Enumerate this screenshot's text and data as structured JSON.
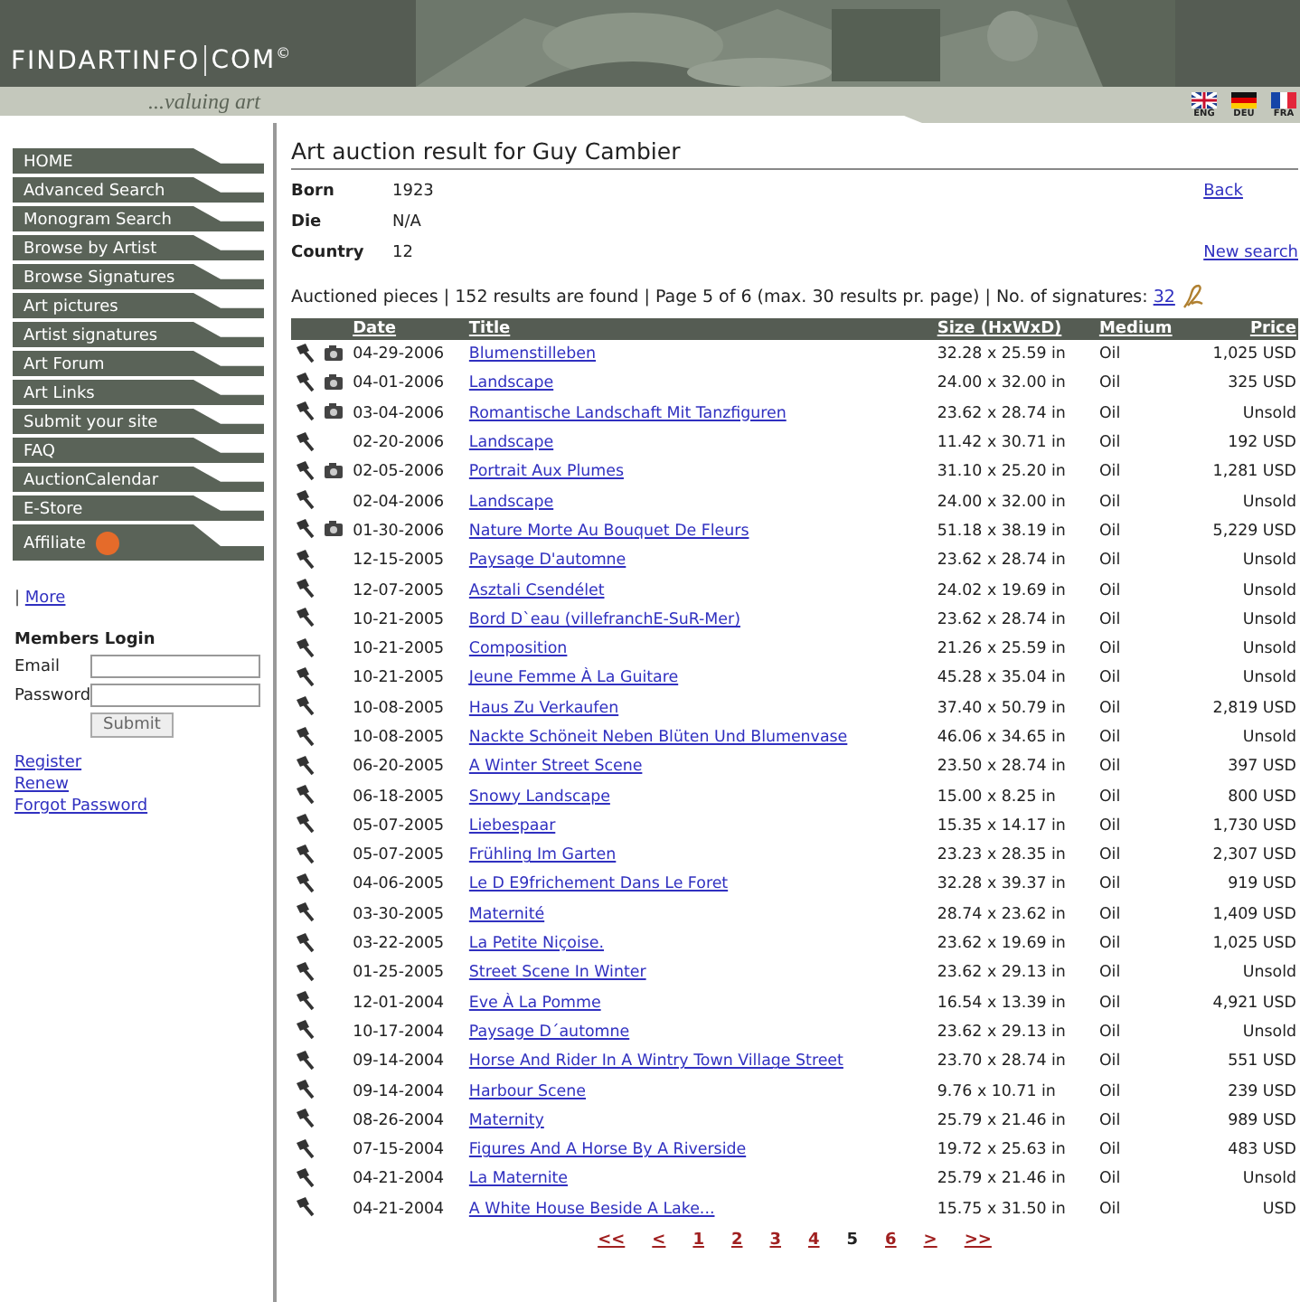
{
  "header": {
    "logo": "FINDARTINFO",
    "logo_suffix": "COM",
    "logo_mark": "©",
    "tagline": "...valuing art",
    "languages": [
      {
        "code": "ENG",
        "kind": "uk"
      },
      {
        "code": "DEU",
        "kind": "de"
      },
      {
        "code": "FRA",
        "kind": "fr"
      }
    ]
  },
  "sidebar": {
    "menu": [
      {
        "label": "HOME",
        "badge": false
      },
      {
        "label": "Advanced Search",
        "badge": false
      },
      {
        "label": "Monogram Search",
        "badge": false
      },
      {
        "label": "Browse by Artist",
        "badge": false
      },
      {
        "label": "Browse Signatures",
        "badge": false
      },
      {
        "label": "Art pictures",
        "badge": false
      },
      {
        "label": "Artist signatures",
        "badge": false
      },
      {
        "label": "Art Forum",
        "badge": false
      },
      {
        "label": "Art Links",
        "badge": false
      },
      {
        "label": "Submit your site",
        "badge": false
      },
      {
        "label": "FAQ",
        "badge": false
      },
      {
        "label": "AuctionCalendar",
        "badge": false
      },
      {
        "label": "E-Store",
        "badge": false
      },
      {
        "label": "Affiliate",
        "badge": true
      }
    ],
    "more_separator": "|",
    "more": "More",
    "login": {
      "title": "Members Login",
      "email_label": "Email",
      "password_label": "Password",
      "submit": "Submit",
      "links": [
        "Register",
        "Renew",
        "Forgot Password"
      ]
    }
  },
  "main": {
    "title": "Art auction result for Guy Cambier",
    "info": [
      {
        "label": "Born",
        "value": "1923",
        "link": "Back"
      },
      {
        "label": "Die",
        "value": "N/A"
      },
      {
        "label": "Country",
        "value": "12",
        "link": "New search"
      }
    ],
    "summary": "Auctioned pieces | 152 results are found | Page 5 of 6 (max. 30 results pr. page) | No. of signatures: ",
    "signatures": "32",
    "table": {
      "columns": [
        "Date",
        "Title",
        "Size (HxWxD)",
        "Medium",
        "Price"
      ],
      "rows": [
        {
          "photo": true,
          "date": "04-29-2006",
          "title": "Blumenstilleben",
          "size": "32.28 x 25.59 in",
          "medium": "Oil",
          "price": "1,025 USD"
        },
        {
          "photo": true,
          "date": "04-01-2006",
          "title": "Landscape",
          "size": "24.00 x 32.00 in",
          "medium": "Oil",
          "price": "325 USD"
        },
        {
          "photo": true,
          "date": "03-04-2006",
          "title": "Romantische Landschaft Mit Tanzfiguren",
          "size": "23.62 x 28.74 in",
          "medium": "Oil",
          "price": "Unsold"
        },
        {
          "photo": false,
          "date": "02-20-2006",
          "title": "Landscape",
          "size": "11.42 x 30.71 in",
          "medium": "Oil",
          "price": "192 USD"
        },
        {
          "photo": true,
          "date": "02-05-2006",
          "title": "Portrait Aux Plumes",
          "size": "31.10 x 25.20 in",
          "medium": "Oil",
          "price": "1,281 USD"
        },
        {
          "photo": false,
          "date": "02-04-2006",
          "title": "Landscape",
          "size": "24.00 x 32.00 in",
          "medium": "Oil",
          "price": "Unsold"
        },
        {
          "photo": true,
          "date": "01-30-2006",
          "title": "Nature Morte Au Bouquet De Fleurs",
          "size": "51.18 x 38.19 in",
          "medium": "Oil",
          "price": "5,229 USD"
        },
        {
          "photo": false,
          "date": "12-15-2005",
          "title": "Paysage D'automne",
          "size": "23.62 x 28.74 in",
          "medium": "Oil",
          "price": "Unsold"
        },
        {
          "photo": false,
          "date": "12-07-2005",
          "title": "Asztali Csendélet",
          "size": "24.02 x 19.69 in",
          "medium": "Oil",
          "price": "Unsold"
        },
        {
          "photo": false,
          "date": "10-21-2005",
          "title": "Bord D`eau (villefranchE-SuR-Mer)",
          "size": "23.62 x 28.74 in",
          "medium": "Oil",
          "price": "Unsold"
        },
        {
          "photo": false,
          "date": "10-21-2005",
          "title": "Composition",
          "size": "21.26 x 25.59 in",
          "medium": "Oil",
          "price": "Unsold"
        },
        {
          "photo": false,
          "date": "10-21-2005",
          "title": "Jeune Femme À La Guitare",
          "size": "45.28 x 35.04 in",
          "medium": "Oil",
          "price": "Unsold"
        },
        {
          "photo": false,
          "date": "10-08-2005",
          "title": "Haus Zu Verkaufen",
          "size": "37.40 x 50.79 in",
          "medium": "Oil",
          "price": "2,819 USD"
        },
        {
          "photo": false,
          "date": "10-08-2005",
          "title": "Nackte Schöneit Neben Blüten Und Blumenvase",
          "size": "46.06 x 34.65 in",
          "medium": "Oil",
          "price": "Unsold"
        },
        {
          "photo": false,
          "date": "06-20-2005",
          "title": "A Winter Street Scene",
          "size": "23.50 x 28.74 in",
          "medium": "Oil",
          "price": "397 USD"
        },
        {
          "photo": false,
          "date": "06-18-2005",
          "title": "Snowy Landscape",
          "size": "15.00 x 8.25 in",
          "medium": "Oil",
          "price": "800 USD"
        },
        {
          "photo": false,
          "date": "05-07-2005",
          "title": "Liebespaar",
          "size": "15.35 x 14.17 in",
          "medium": "Oil",
          "price": "1,730 USD"
        },
        {
          "photo": false,
          "date": "05-07-2005",
          "title": "Frühling Im Garten",
          "size": "23.23 x 28.35 in",
          "medium": "Oil",
          "price": "2,307 USD"
        },
        {
          "photo": false,
          "date": "04-06-2005",
          "title": "Le D E9frichement Dans Le Foret",
          "size": "32.28 x 39.37 in",
          "medium": "Oil",
          "price": "919 USD"
        },
        {
          "photo": false,
          "date": "03-30-2005",
          "title": "Maternité",
          "size": "28.74 x 23.62 in",
          "medium": "Oil",
          "price": "1,409 USD"
        },
        {
          "photo": false,
          "date": "03-22-2005",
          "title": "La Petite Niçoise.",
          "size": "23.62 x 19.69 in",
          "medium": "Oil",
          "price": "1,025 USD"
        },
        {
          "photo": false,
          "date": "01-25-2005",
          "title": "Street Scene In Winter",
          "size": "23.62 x 29.13 in",
          "medium": "Oil",
          "price": "Unsold"
        },
        {
          "photo": false,
          "date": "12-01-2004",
          "title": "Eve À La Pomme",
          "size": "16.54 x 13.39 in",
          "medium": "Oil",
          "price": "4,921 USD"
        },
        {
          "photo": false,
          "date": "10-17-2004",
          "title": "Paysage D´automne",
          "size": "23.62 x 29.13 in",
          "medium": "Oil",
          "price": "Unsold"
        },
        {
          "photo": false,
          "date": "09-14-2004",
          "title": "Horse And Rider In A Wintry Town Village Street",
          "size": "23.70 x 28.74 in",
          "medium": "Oil",
          "price": "551 USD"
        },
        {
          "photo": false,
          "date": "09-14-2004",
          "title": "Harbour Scene",
          "size": "9.76 x 10.71 in",
          "medium": "Oil",
          "price": "239 USD"
        },
        {
          "photo": false,
          "date": "08-26-2004",
          "title": "Maternity",
          "size": "25.79 x 21.46 in",
          "medium": "Oil",
          "price": "989 USD"
        },
        {
          "photo": false,
          "date": "07-15-2004",
          "title": "Figures And A Horse By A Riverside",
          "size": "19.72 x 25.63 in",
          "medium": "Oil",
          "price": "483 USD"
        },
        {
          "photo": false,
          "date": "04-21-2004",
          "title": "La Maternite",
          "size": "25.79 x 21.46 in",
          "medium": "Oil",
          "price": "Unsold"
        },
        {
          "photo": false,
          "date": "04-21-2004",
          "title": "A White House Beside A Lake...",
          "size": "15.75 x 31.50 in",
          "medium": "Oil",
          "price": "USD"
        }
      ]
    },
    "pagination": [
      {
        "label": "<<",
        "selected": false
      },
      {
        "label": "<",
        "selected": false
      },
      {
        "label": "1",
        "selected": false
      },
      {
        "label": "2",
        "selected": false
      },
      {
        "label": "3",
        "selected": false
      },
      {
        "label": "4",
        "selected": false
      },
      {
        "label": "5",
        "selected": true
      },
      {
        "label": "6",
        "selected": false
      },
      {
        "label": ">",
        "selected": false
      },
      {
        "label": ">>",
        "selected": false
      }
    ]
  }
}
